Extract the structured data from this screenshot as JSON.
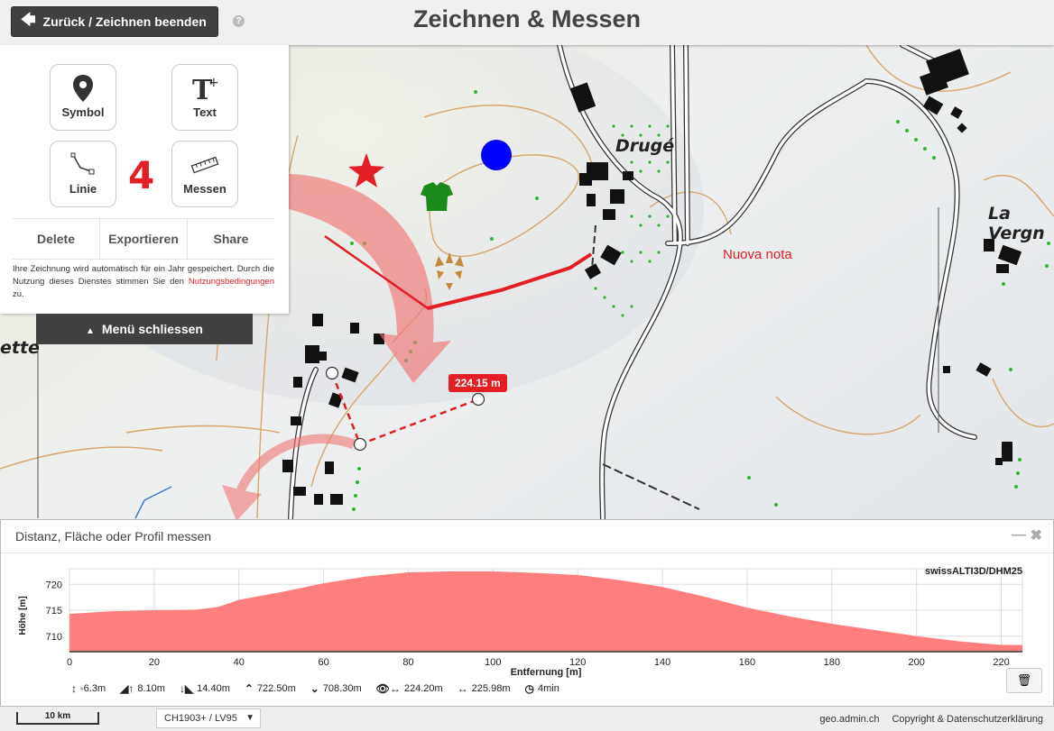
{
  "header": {
    "back_label": "Zurück / Zeichnen beenden",
    "help_icon": "?",
    "title": "Zeichnen & Messen"
  },
  "panel": {
    "tools": {
      "symbol": "Symbol",
      "text": "Text",
      "line": "Linie",
      "measure": "Messen"
    },
    "step_number": "4",
    "actions": [
      "Delete",
      "Exportieren",
      "Share"
    ],
    "info_text": "Ihre Zeichnung wird automatisch für ein Jahr gespeichert. Durch die Nutzung dieses Dienstes stimmen Sie den ",
    "info_link": "Nutzungsbedingungen",
    "info_suffix": " zu.",
    "menu_close": "Menü schliessen"
  },
  "map": {
    "place_labels": [
      "Drugé",
      "La Vergn",
      "ette"
    ],
    "note_label": "Nuova nota",
    "measure_label": "224.15 m",
    "colors": {
      "drawing_red": "#e31e24",
      "marker_blue": "#0000ff",
      "shirt_green": "#1a8a1a"
    }
  },
  "profile": {
    "title": "Distanz, Fläche oder Profil messen",
    "min_icon": "—",
    "close_icon": "✖",
    "source": "swissALTI3D/DHM25",
    "ylabel": "Höhe [m]",
    "xlabel": "Entfernung [m]",
    "stats": [
      {
        "icon": "↕",
        "text": "-6.3m"
      },
      {
        "icon": "◢↑",
        "text": "8.10m"
      },
      {
        "icon": "↓◣",
        "text": "14.40m"
      },
      {
        "icon": "⌃",
        "text": "722.50m"
      },
      {
        "icon": "⌄",
        "text": "708.30m"
      },
      {
        "icon": "👁↔",
        "text": "224.20m"
      },
      {
        "icon": "↔",
        "text": "225.98m"
      },
      {
        "icon": "◷",
        "text": "4min"
      }
    ]
  },
  "chart_data": {
    "type": "area",
    "title": "",
    "xlabel": "Entfernung [m]",
    "ylabel": "Höhe [m]",
    "xlim": [
      0,
      225
    ],
    "ylim": [
      707,
      723
    ],
    "xticks": [
      0,
      20,
      40,
      60,
      80,
      100,
      120,
      140,
      160,
      180,
      200,
      220
    ],
    "yticks": [
      710,
      715,
      720
    ],
    "x": [
      0,
      10,
      20,
      30,
      35,
      40,
      50,
      60,
      70,
      80,
      90,
      100,
      110,
      120,
      130,
      140,
      150,
      160,
      170,
      180,
      190,
      200,
      210,
      220,
      225
    ],
    "y": [
      714.3,
      714.8,
      715.0,
      715.1,
      715.6,
      717.0,
      718.5,
      720.2,
      721.5,
      722.3,
      722.5,
      722.5,
      722.2,
      721.8,
      720.8,
      719.5,
      717.6,
      715.5,
      713.8,
      712.4,
      711.2,
      710.0,
      709.0,
      708.3,
      708.3
    ],
    "grid": true,
    "fill_color": "#ff7f7f"
  },
  "bottom": {
    "scale": "10 km",
    "crs": "CH1903+ / LV95",
    "crs_caret": "▼",
    "site": "geo.admin.ch",
    "copyright": "Copyright & Datenschutzerklärung"
  }
}
